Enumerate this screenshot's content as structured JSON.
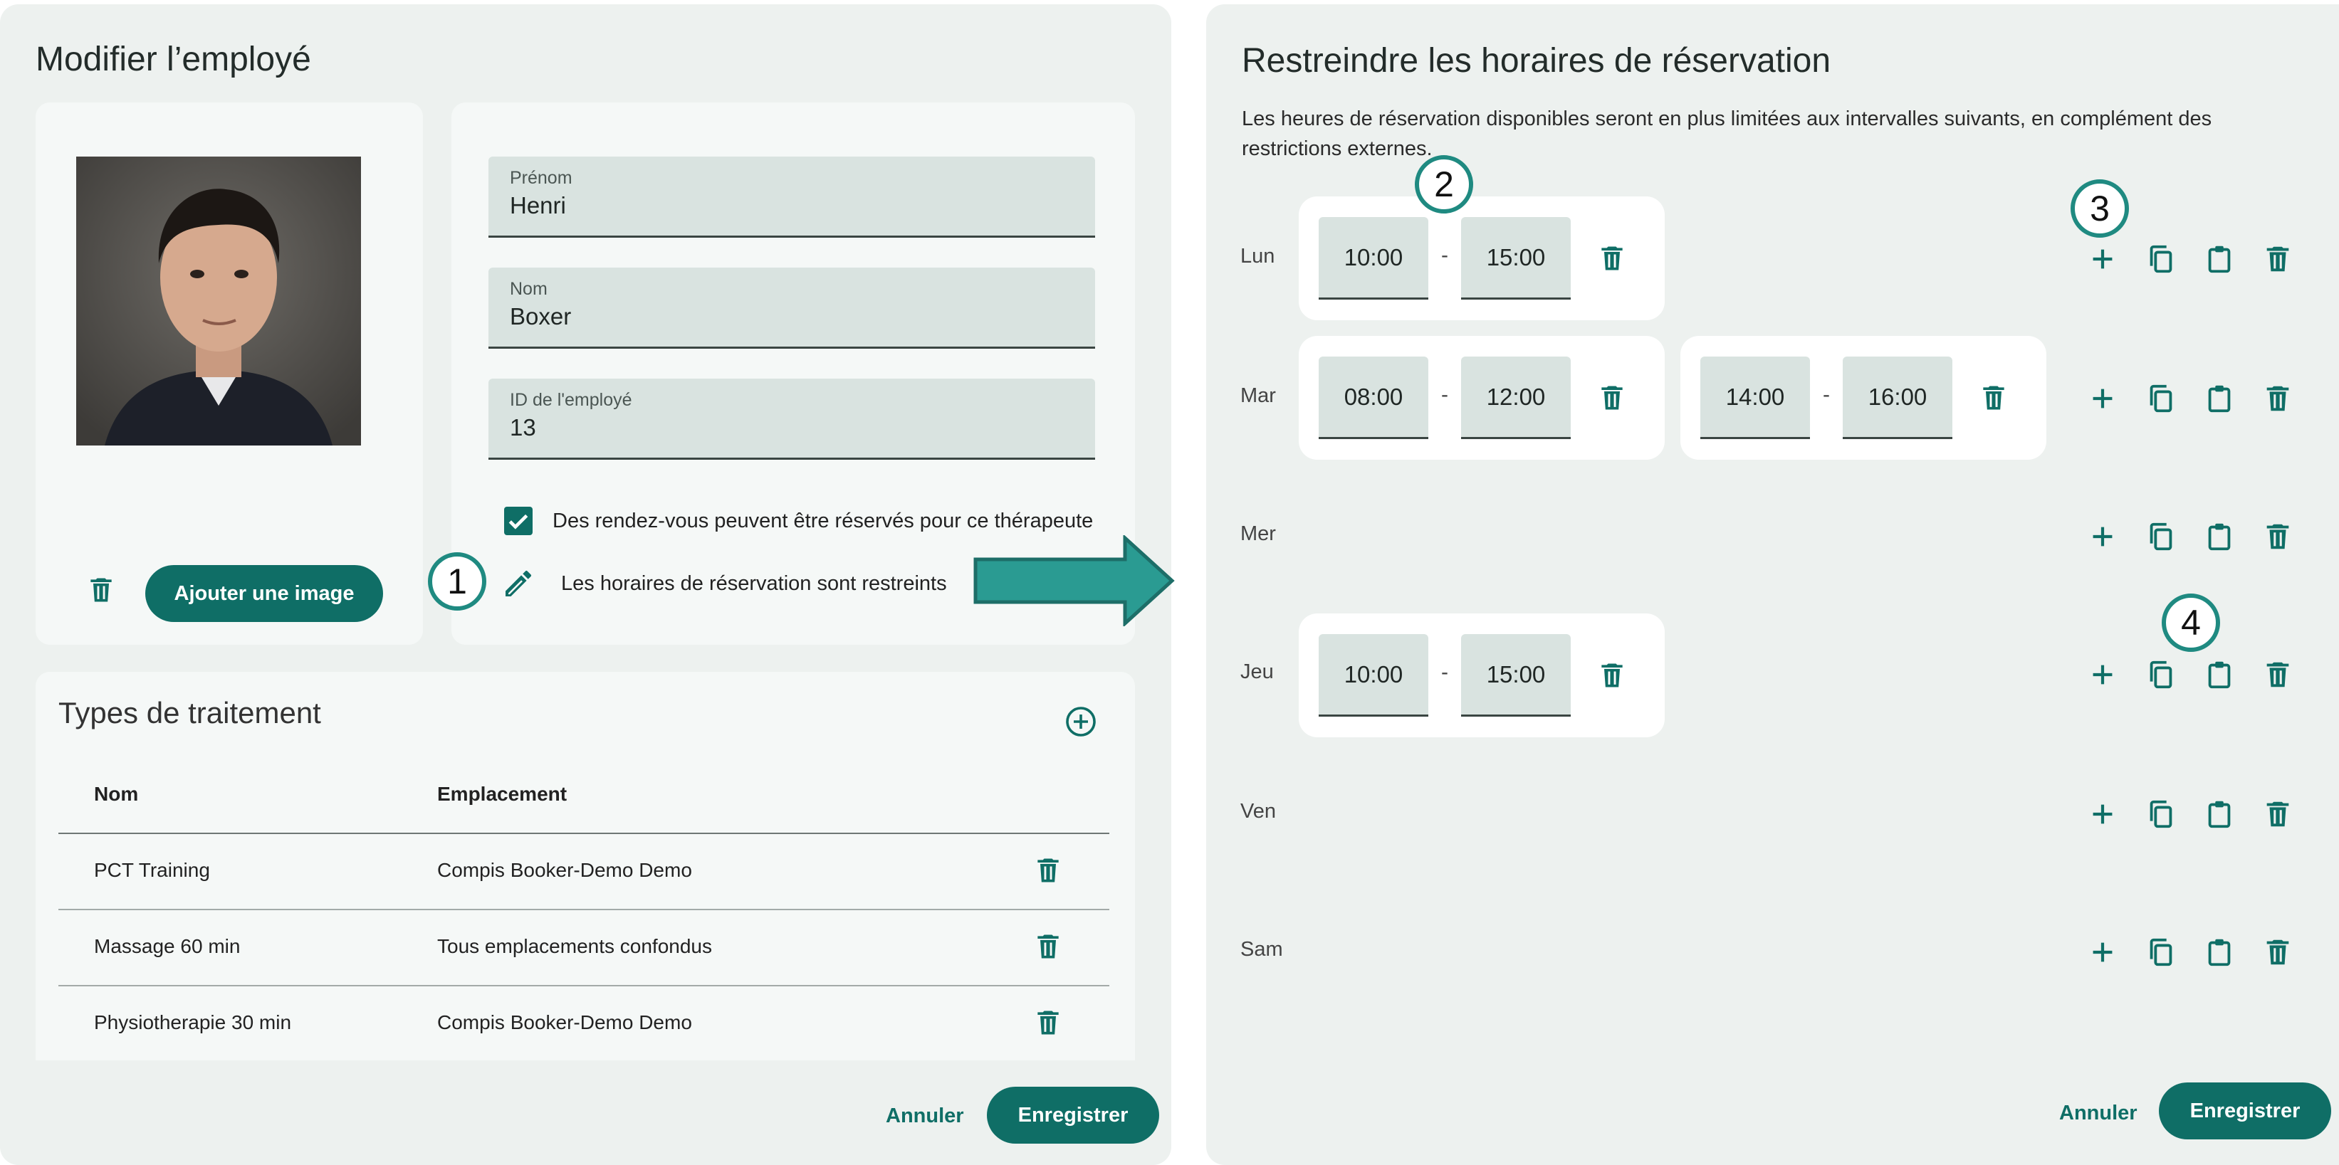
{
  "left": {
    "title": "Modifier l’employé",
    "photo": {
      "alt": "Photo de l'employé"
    },
    "add_image_label": "Ajouter une image",
    "fields": {
      "first_name": {
        "label": "Prénom",
        "value": "Henri"
      },
      "last_name": {
        "label": "Nom",
        "value": "Boxer"
      },
      "employee_id": {
        "label": "ID de l'employé",
        "value": "13"
      }
    },
    "bookable_label": "Des rendez-vous peuvent être réservés pour ce thérapeute",
    "bookable_checked": true,
    "restricted_label": "Les horaires de réservation sont restreints",
    "treatments": {
      "title": "Types de traitement",
      "columns": [
        "Nom",
        "Emplacement"
      ],
      "rows": [
        {
          "name": "PCT Training",
          "location": "Compis Booker-Demo Demo"
        },
        {
          "name": "Massage 60 min",
          "location": "Tous emplacements confondus"
        },
        {
          "name": "Physiotherapie 30 min",
          "location": "Compis Booker-Demo Demo"
        }
      ]
    },
    "cancel_label": "Annuler",
    "save_label": "Enregistrer"
  },
  "right": {
    "title": "Restreindre les horaires de réservation",
    "description": "Les heures de réservation disponibles seront en plus limitées aux intervalles suivants, en complément des restrictions externes.",
    "days": [
      {
        "label": "Lun",
        "slots": [
          {
            "start": "10:00",
            "end": "15:00"
          }
        ]
      },
      {
        "label": "Mar",
        "slots": [
          {
            "start": "08:00",
            "end": "12:00"
          },
          {
            "start": "14:00",
            "end": "16:00"
          }
        ]
      },
      {
        "label": "Mer",
        "slots": []
      },
      {
        "label": "Jeu",
        "slots": [
          {
            "start": "10:00",
            "end": "15:00"
          }
        ]
      },
      {
        "label": "Ven",
        "slots": []
      },
      {
        "label": "Sam",
        "slots": []
      }
    ],
    "separator": "-",
    "cancel_label": "Annuler",
    "save_label": "Enregistrer"
  },
  "callouts": [
    "1",
    "2",
    "3",
    "4"
  ],
  "colors": {
    "accent": "#0f6e66",
    "arrow": "#2a9b92",
    "panel": "#edf1ef",
    "field": "#d9e3e0"
  }
}
